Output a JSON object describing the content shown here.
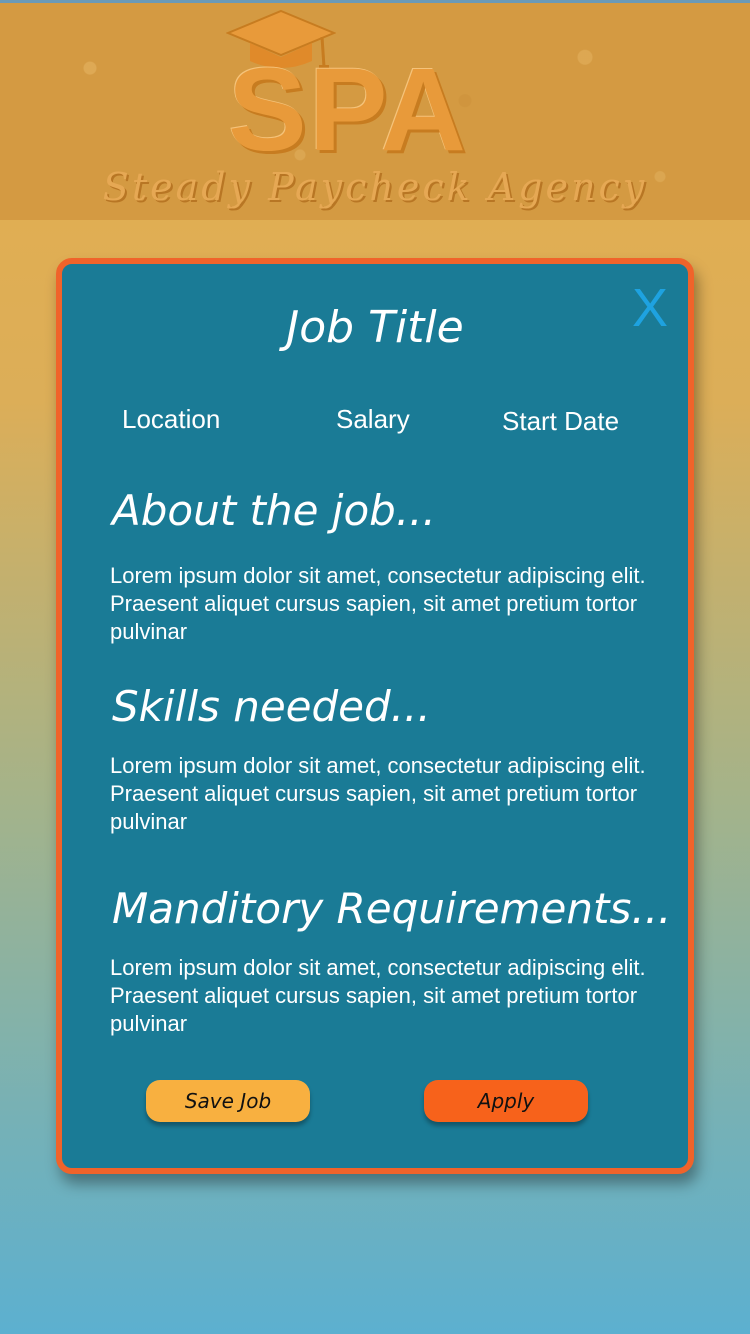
{
  "header": {
    "logo_text": "SPA",
    "tagline": "Steady Paycheck Agency",
    "icon": "graduation-cap-icon"
  },
  "modal": {
    "close_label": "X",
    "title": "Job Title",
    "meta": {
      "location": "Location",
      "salary": "Salary",
      "start_date": "Start Date"
    },
    "sections": [
      {
        "heading": "About the job...",
        "body": "Lorem ipsum dolor sit amet, consectetur adipiscing elit. Praesent aliquet cursus sapien, sit amet pretium tortor pulvinar"
      },
      {
        "heading": "Skills needed...",
        "body": "Lorem ipsum dolor sit amet, consectetur adipiscing elit. Praesent aliquet cursus sapien, sit amet pretium tortor pulvinar"
      },
      {
        "heading": "Manditory Requirements...",
        "body": "Lorem ipsum dolor sit amet, consectetur adipiscing elit. Praesent aliquet cursus sapien, sit amet pretium tortor pulvinar"
      }
    ],
    "buttons": {
      "save": "Save Job",
      "apply": "Apply"
    }
  },
  "colors": {
    "modal_bg": "#1a7b96",
    "modal_border": "#f0632a",
    "close": "#1ea2e0",
    "save_button": "#f8b040",
    "apply_button": "#f7621b"
  }
}
